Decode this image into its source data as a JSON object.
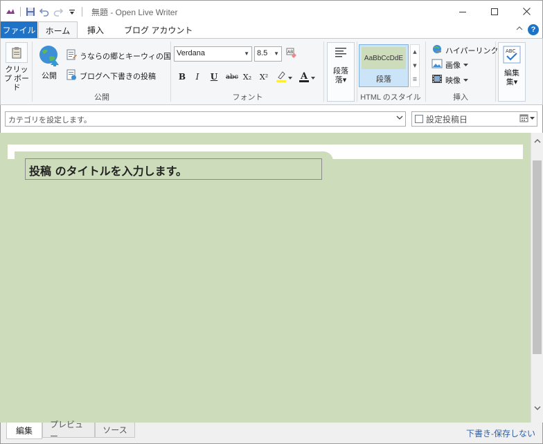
{
  "window": {
    "title": "無題 - Open Live Writer",
    "controls": [
      "minimize",
      "maximize",
      "close"
    ]
  },
  "ribbon_tabs": {
    "file": "ファイル",
    "home": "ホーム",
    "insert": "挿入",
    "account": "ブログ アカウント"
  },
  "groups": {
    "clipboard": {
      "label": "クリップ ボード"
    },
    "publish": {
      "label": "公開",
      "publish_button": "公開",
      "blog_selector": "うならの郷とキーウィの国",
      "post_draft": "ブログへ下書きの投稿"
    },
    "font": {
      "label": "フォント",
      "font_name": "Verdana",
      "font_size": "8.5",
      "bold": "B",
      "italic": "I",
      "underline": "U",
      "strike": "abc",
      "subscript": "X₂",
      "superscript": "X²"
    },
    "paragraph": {
      "label": "段落"
    },
    "html_style": {
      "label": "HTML のスタイル",
      "preview": "AaBbCcDdE",
      "style_name": "段落"
    },
    "insert": {
      "label": "挿入",
      "hyperlink": "ハイパーリンク",
      "image": "画像",
      "video": "映像"
    },
    "edit": {
      "label": "編集"
    }
  },
  "category": {
    "placeholder": "カテゴリを設定します。",
    "date_label": "設定投稿日"
  },
  "editor": {
    "title_placeholder": "投稿 のタイトルを入力します。"
  },
  "bottom_tabs": [
    "編集",
    "プレビュー",
    "ソース"
  ],
  "status": "下書き-保存しない",
  "colors": {
    "accent": "#1e73c6",
    "editor_bg": "#cddcbb",
    "ribbon_bg": "#f5f6f7"
  }
}
